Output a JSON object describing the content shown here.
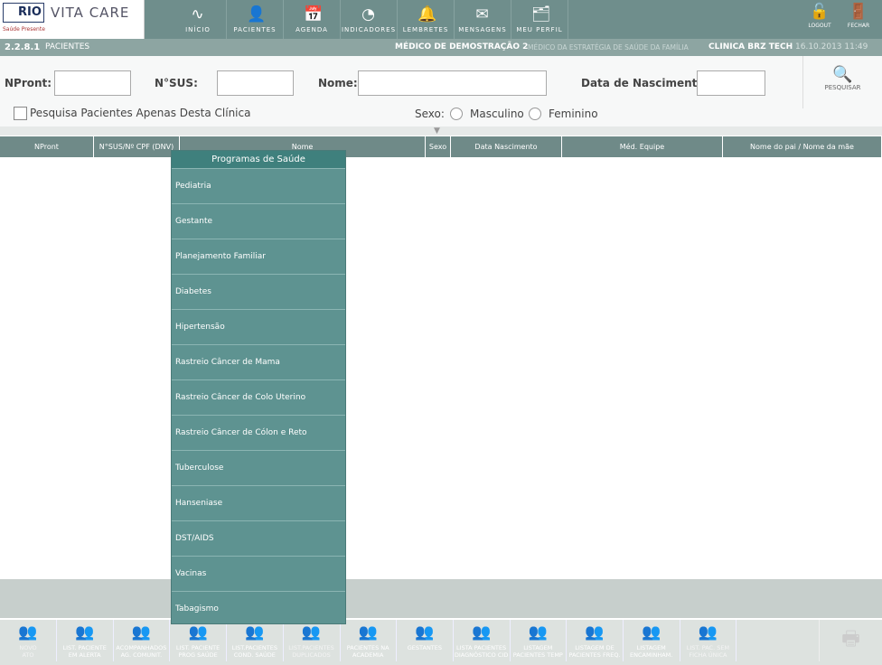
{
  "header": {
    "logo_rio": "RIO",
    "logo_vitacare": "VITA CARE",
    "logo_saude": "Saúde Presente",
    "nav": [
      {
        "label": "INÍCIO",
        "icon": "pulse-icon"
      },
      {
        "label": "PACIENTES",
        "icon": "patient-icon"
      },
      {
        "label": "AGENDA",
        "icon": "calendar-icon"
      },
      {
        "label": "INDICADORES",
        "icon": "chart-icon"
      },
      {
        "label": "LEMBRETES",
        "icon": "bell-icon"
      },
      {
        "label": "MENSAGENS",
        "icon": "envelope-icon"
      },
      {
        "label": "MEU PERFIL",
        "icon": "profile-icon"
      }
    ],
    "logout": "LOGOUT",
    "fechar": "FECHAR"
  },
  "subheader": {
    "code": "2.2.8.1",
    "title": "PACIENTES",
    "doctor": "MÉDICO DE DEMOSTRAÇÃO 2",
    "role": "MÉDICO DA ESTRATÉGIA DE SAÚDE DA FAMÍLIA",
    "clinic": "CLINICA BRZ TECH",
    "datetime": "16.10.2013 11:49"
  },
  "search": {
    "npront_label": "NPront:",
    "nsus_label": "N°SUS:",
    "nome_label": "Nome:",
    "nasc_label": "Data de Nascimento:",
    "pesquisar": "PESQUISAR",
    "clinic_only": "Pesquisa Pacientes Apenas Desta Clínica",
    "sexo_label": "Sexo:",
    "masculino": "Masculino",
    "feminino": "Feminino"
  },
  "table": {
    "columns": [
      "NPront",
      "N°SUS/Nº CPF (DNV)",
      "Nome",
      "Sexo",
      "Data Nascimento",
      "Méd. Equipe",
      "Nome do pai / Nome da mãe"
    ]
  },
  "menu": {
    "title": "Programas de Saúde",
    "items": [
      "Pediatria",
      "Gestante",
      "Planejamento Familiar",
      "Diabetes",
      "Hipertensão",
      "Rastreio Câncer de Mama",
      "Rastreio Câncer de Colo Uterino",
      "Rastreio Câncer de Cólon e Reto",
      "Tuberculose",
      "Hanseniase",
      "DST/AIDS",
      "Vacinas",
      "Tabagismo"
    ]
  },
  "toolbar": [
    {
      "l1": "NOVO",
      "l2": "ATO",
      "dis": true
    },
    {
      "l1": "LIST. PACIENTE",
      "l2": "EM ALERTA"
    },
    {
      "l1": "ACOMPANHADOS",
      "l2": "AG. COMUNIT."
    },
    {
      "l1": "LIST. PACIENTE",
      "l2": "PROG SAÚDE"
    },
    {
      "l1": "LIST.PACIENTES",
      "l2": "COND. SAÚDE"
    },
    {
      "l1": "LIST.PACIENTES",
      "l2": "DUPLICADOS",
      "dis": true
    },
    {
      "l1": "PACIENTES NA",
      "l2": "ACADEMIA"
    },
    {
      "l1": "GESTANTES",
      "l2": ""
    },
    {
      "l1": "LISTA PACIENTES",
      "l2": "DIAGNÓSTICO CID"
    },
    {
      "l1": "LISTAGEM",
      "l2": "PACIENTES TEMP"
    },
    {
      "l1": "LISTAGEM DE",
      "l2": "PACIENTES FREQ."
    },
    {
      "l1": "LISTAGEM",
      "l2": "ENCAMINHAM."
    },
    {
      "l1": "LIST. PAC. SEM",
      "l2": "FICHA ÚNICA",
      "dis": true
    }
  ]
}
